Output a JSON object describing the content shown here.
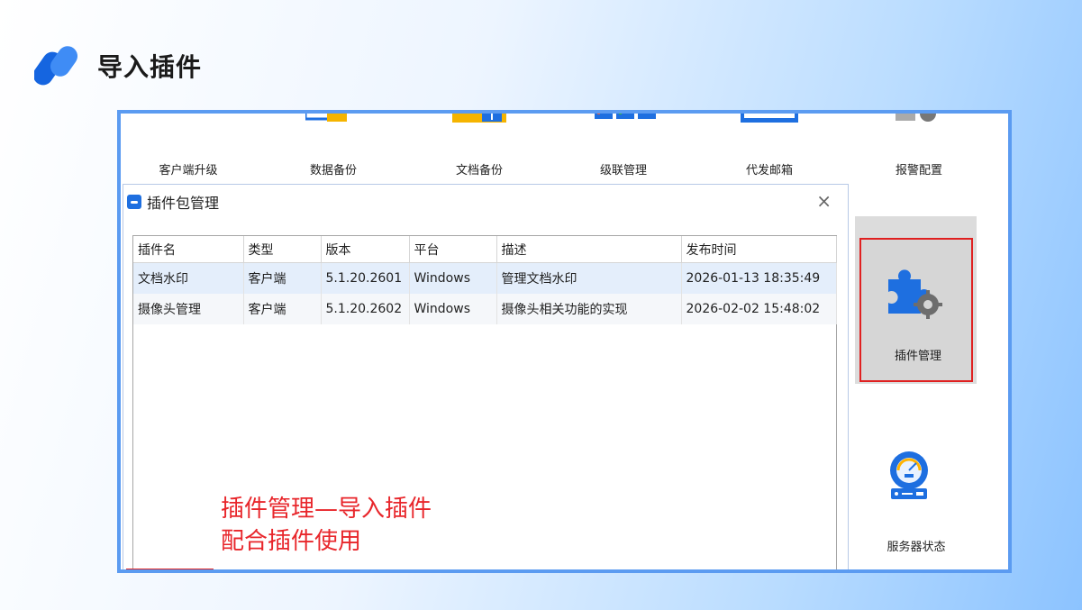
{
  "slide": {
    "title": "导入插件"
  },
  "toolbar": {
    "items": [
      {
        "label": "客户端升级",
        "icon": "monitor-icon"
      },
      {
        "label": "数据备份",
        "icon": "data-backup-icon"
      },
      {
        "label": "文档备份",
        "icon": "folder-backup-icon"
      },
      {
        "label": "级联管理",
        "icon": "cascade-icon"
      },
      {
        "label": "代发邮箱",
        "icon": "mail-icon"
      },
      {
        "label": "报警配置",
        "icon": "alarm-config-icon"
      }
    ]
  },
  "dialog": {
    "title": "插件包管理",
    "close_glyph": "×",
    "columns": [
      "插件名",
      "类型",
      "版本",
      "平台",
      "描述",
      "发布时间"
    ],
    "rows": [
      [
        "文档水印",
        "客户端",
        "5.1.20.2601",
        "Windows",
        "管理文档水印",
        "2026-01-13 18:35:49"
      ],
      [
        "摄像头管理",
        "客户端",
        "5.1.20.2602",
        "Windows",
        "摄像头相关功能的实现",
        "2026-02-02 15:48:02"
      ]
    ]
  },
  "annotation": {
    "line1": "插件管理—导入插件",
    "line2": "配合插件使用"
  },
  "side": {
    "plugin_label": "插件管理",
    "server_label": "服务器状态"
  },
  "colors": {
    "frame": "#5b9bf1",
    "accent": "#1e6fe0",
    "highlight": "#e02020",
    "annotation": "#e8262b"
  }
}
